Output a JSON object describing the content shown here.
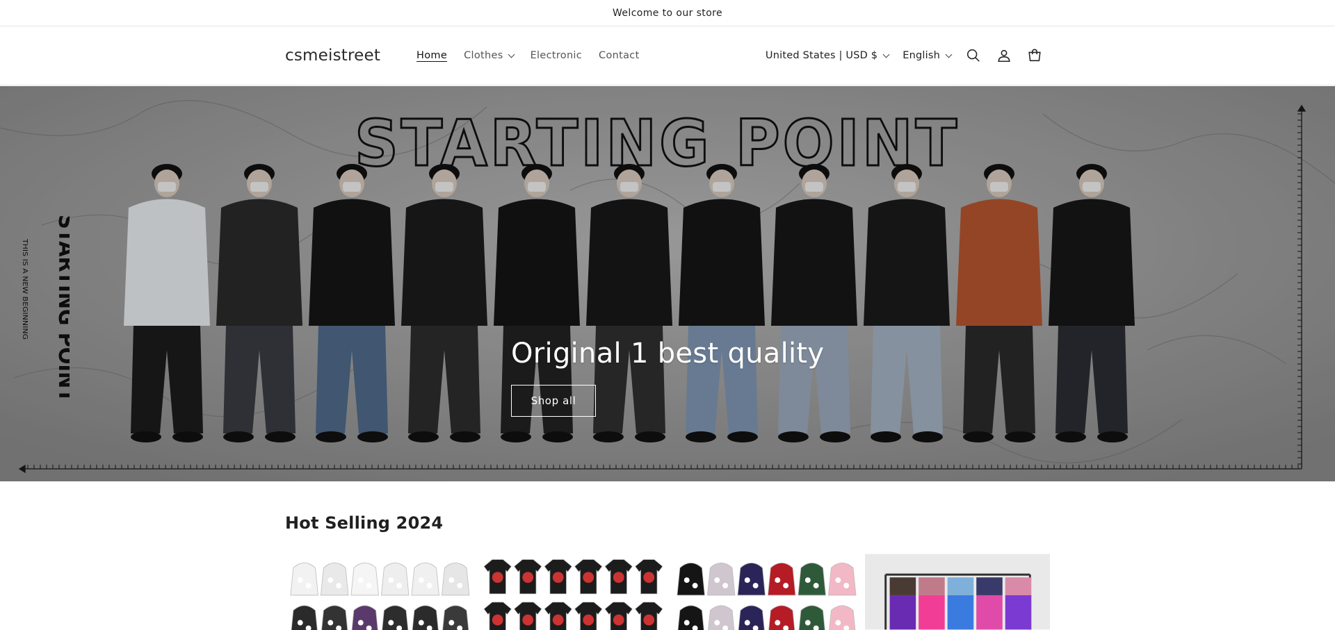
{
  "announcement": "Welcome to our store",
  "header": {
    "logo": "csmeistreet",
    "nav": [
      {
        "label": "Home",
        "active": true
      },
      {
        "label": "Clothes",
        "dropdown": true
      },
      {
        "label": "Electronic"
      },
      {
        "label": "Contact"
      }
    ],
    "country_selector": "United States | USD $",
    "language_selector": "English",
    "icons": [
      "search-icon",
      "account-icon",
      "cart-icon"
    ]
  },
  "hero": {
    "art_title": "STARTING POINT",
    "side_title": "STARTING POINT",
    "side_subtitle": "THIS IS A NEW BEGINNING",
    "heading": "Original 1 best quality",
    "button": "Shop all"
  },
  "featured": {
    "title": "Hot Selling 2024",
    "products": [
      {
        "name": "white-hoodies-grid"
      },
      {
        "name": "black-tees-grid"
      },
      {
        "name": "hoodie-sets-grid"
      },
      {
        "name": "shorts-rack"
      }
    ]
  },
  "colors": {
    "text": "#121212",
    "muted": "#555555",
    "border": "#e6e6e6",
    "hero_bg": "#9a9a9a"
  }
}
